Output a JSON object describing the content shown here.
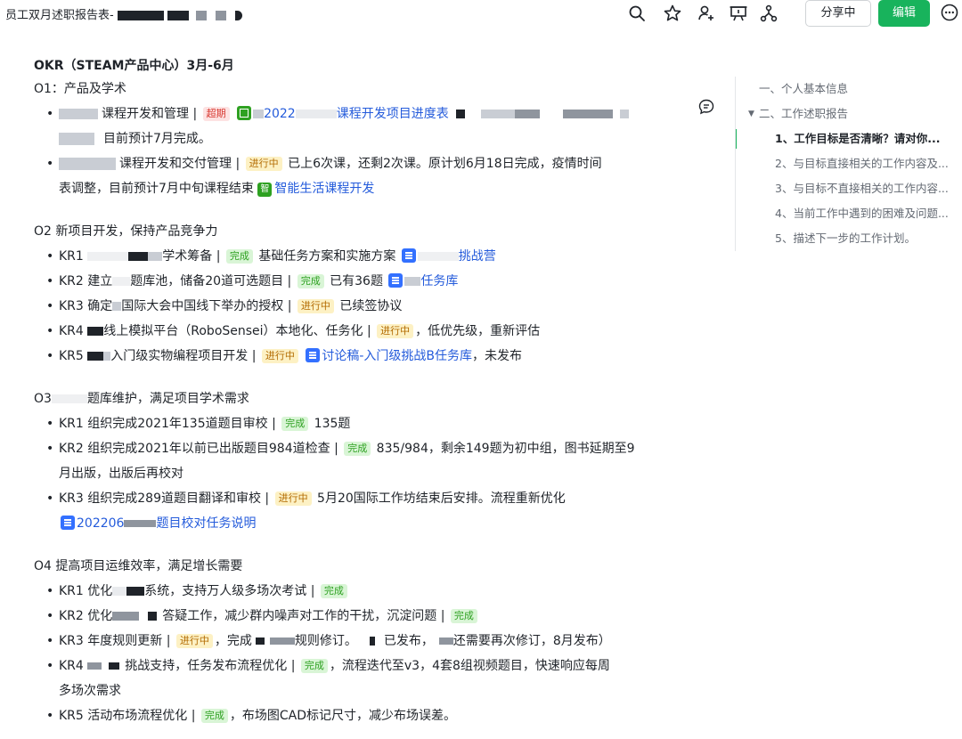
{
  "doc": {
    "title": "员工双月述职报告表-"
  },
  "toolbar": {
    "share_label": "分享中",
    "edit_label": "编辑",
    "icons": [
      "search-icon",
      "star-icon",
      "add-user-icon",
      "present-icon",
      "org-chart-icon",
      "more-icon"
    ]
  },
  "okr": {
    "heading": "OKR（STEAM产品中心）3月-6月",
    "o1": {
      "title": "O1：产品及学术",
      "items": [
        {
          "pre": "课程开发和管理 | ",
          "tag": "超期",
          "link": "2022",
          "link2": "课程开发项目进度表",
          "line2": "目前预计7月完成。"
        },
        {
          "pre": "课程开发和交付管理 | ",
          "tag": "进行中",
          "post": " 已上6次课，还剩2次课。原计划6月18日完成，疫情时间",
          "line2": "表调整，目前预计7月中旬课程结束 ",
          "app_icon": "智",
          "link": "智能生活课程开发"
        }
      ]
    },
    "o2": {
      "title": "O2 新项目开发，保持产品竞争力",
      "items": [
        {
          "pre": "KR1 ",
          "mid": "学术筹备 | ",
          "tag": "完成",
          "post": " 基础任务方案和实施方案 ",
          "link": "挑战营"
        },
        {
          "pre": "KR2 建立",
          "mid": "题库池，储备20道可选题目 | ",
          "tag": "完成",
          "post": " 已有36题 ",
          "link": "任务库"
        },
        {
          "pre": "KR3 确定",
          "mid": "国际大会中国线下举办的授权 | ",
          "tag": "进行中",
          "post": " 已续签协议"
        },
        {
          "pre": "KR4 ",
          "mid": "线上模拟平台（RoboSensei）本地化、任务化 | ",
          "tag": "进行中",
          "post": "，低优先级，重新评估"
        },
        {
          "pre": "KR5 ",
          "mid": "入门级实物编程项目开发 | ",
          "tag": "进行中",
          "link": "讨论稿-入门级挑战B任务库",
          "post": "，未发布"
        }
      ]
    },
    "o3": {
      "title_pre": "O3",
      "title_post": "题库维护，满足项目学术需求",
      "items": [
        {
          "pre": "KR1 组织完成2021年135道题目审校 | ",
          "tag": "完成",
          "post": " 135题"
        },
        {
          "pre": "KR2 组织完成2021年以前已出版题目984道检查 | ",
          "tag": "完成",
          "post": " 835/984，剩余149题为初中组，图书延期至9",
          "line2": "月出版，出版后再校对"
        },
        {
          "pre": "KR3 组织完成289道题目翻译和审校 | ",
          "tag": "进行中",
          "post": " 5月20国际工作坊结束后安排。流程重新优化",
          "link_pre": "202206",
          "link": "题目校对任务说明"
        }
      ]
    },
    "o4": {
      "title": "O4 提高项目运维效率，满足增长需要",
      "items": [
        {
          "pre": "KR1 优化",
          "mid": "系统，支持万人级多场次考试 | ",
          "tag": "完成"
        },
        {
          "pre": "KR2 优化",
          "mid": "答疑工作，减少群内噪声对工作的干扰，沉淀问题 | ",
          "tag": "完成"
        },
        {
          "pre": "KR3 年度规则更新 | ",
          "tag": "进行中",
          "post": "，完成",
          "mid": "规则修订。",
          "post2": "已发布，",
          "post3": "还需要再次修订，8月发布）"
        },
        {
          "pre": "KR4 ",
          "mid": "挑战支持，任务发布流程优化 | ",
          "tag": "完成",
          "post": "，流程迭代至v3，4套8组视频题目，快速响应每周",
          "line2": "多场次需求"
        },
        {
          "pre": "KR5 活动布场流程优化 | ",
          "tag": "完成",
          "post": "，布场图CAD标记尺寸，减少布场误差。"
        }
      ]
    }
  },
  "outline": {
    "items": [
      {
        "label": "一、个人基本信息"
      },
      {
        "label": "二、工作述职报告"
      },
      {
        "label": "1、工作目标是否清晰？请对你..."
      },
      {
        "label": "2、与目标直接相关的工作内容及..."
      },
      {
        "label": "3、与目标不直接相关的工作内容..."
      },
      {
        "label": "4、当前工作中遇到的困难及问题..."
      },
      {
        "label": "5、描述下一步的工作计划。"
      }
    ]
  },
  "colors": {
    "accent": "#18b35c",
    "link": "#245bdb",
    "overdue": "#d83931",
    "progress": "#b26a00",
    "done": "#2ea121"
  }
}
